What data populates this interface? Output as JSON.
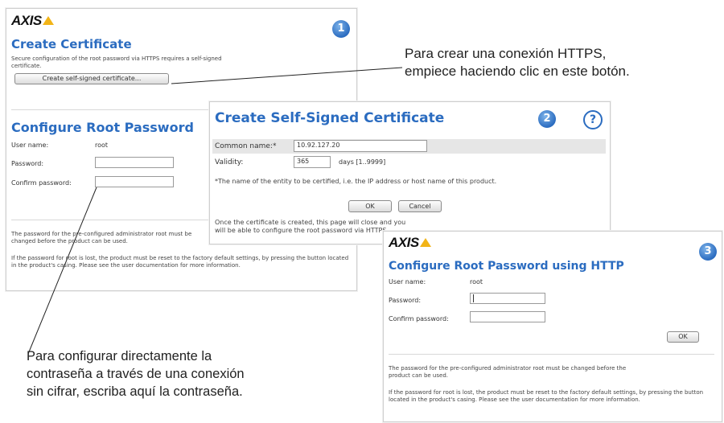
{
  "panel1": {
    "logo": "AXIS",
    "badge": "1",
    "create_title": "Create Certificate",
    "create_desc": "Secure configuration of the root password via HTTPS requires a self-signed certificate.",
    "create_button": "Create self-signed certificate...",
    "config_title": "Configure Root Password",
    "user_label": "User name:",
    "user_value": "root",
    "password_label": "Password:",
    "confirm_label": "Confirm password:",
    "note1": "The password for the pre-configured administrator root must be changed before the product can be used.",
    "note2": "If the password for root is lost, the product must be reset to the factory default settings, by pressing the button located in the product's casing. Please see the user documentation for more information."
  },
  "panel2": {
    "title": "Create Self-Signed Certificate",
    "badge": "2",
    "help": "?",
    "common_name_label": "Common name:*",
    "common_name_value": "10.92.127.20",
    "validity_label": "Validity:",
    "validity_value": "365",
    "validity_unit": "days [1..9999]",
    "footnote": "*The name of the entity to be certified, i.e. the IP address or host name of this product.",
    "ok": "OK",
    "cancel": "Cancel",
    "note": "Once the certificate is created, this page will close and you will be able to configure the root password via HTTPS."
  },
  "panel3": {
    "logo": "AXIS",
    "badge": "3",
    "title": "Configure Root Password using HTTP",
    "user_label": "User name:",
    "user_value": "root",
    "password_label": "Password:",
    "confirm_label": "Confirm password:",
    "ok": "OK",
    "note1": "The password for the pre-configured administrator root must be changed before the product can be used.",
    "note2": "If the password for root is lost, the product must be reset to the factory default settings, by pressing the button located in the product's casing. Please see the user documentation for more information."
  },
  "annotations": {
    "https_line1": "Para crear una conexión HTTPS,",
    "https_line2": "empiece haciendo clic en este botón.",
    "plain_line1": "Para configurar directamente la",
    "plain_line2": "contraseña a través de una conexión",
    "plain_line3": "sin cifrar, escriba aquí la contraseña."
  }
}
